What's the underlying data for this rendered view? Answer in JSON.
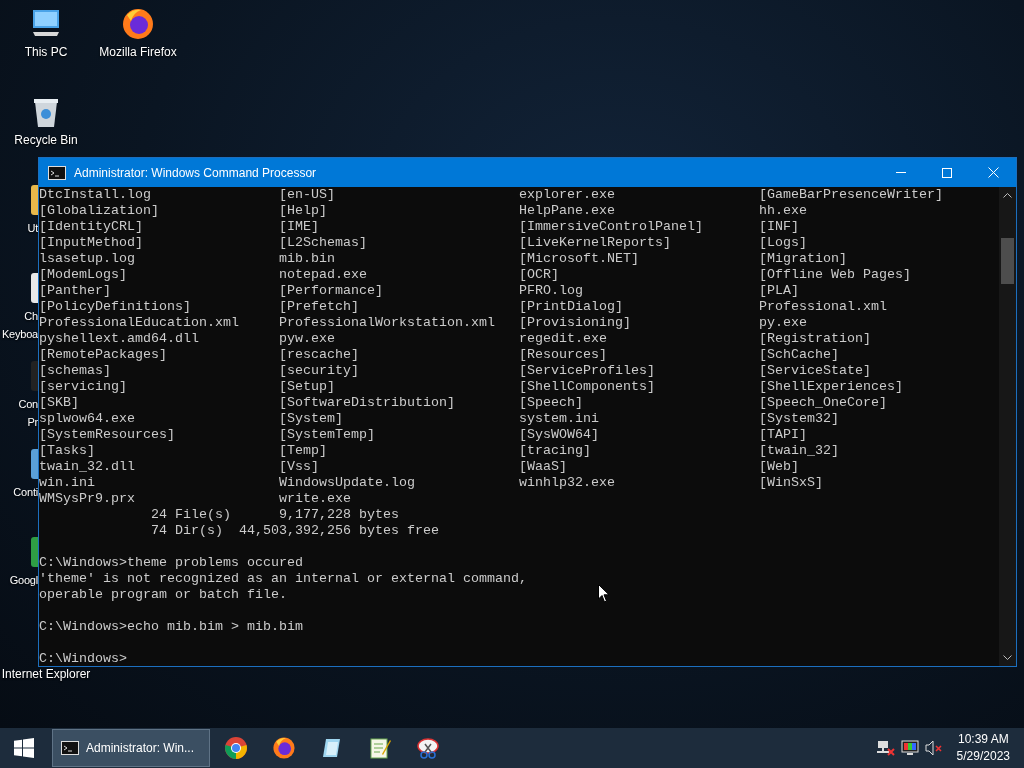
{
  "desktop": {
    "columns": [
      [
        {
          "kind": "pc",
          "label_lines": [
            "This PC"
          ],
          "partly_hidden": false
        },
        {
          "kind": "bin",
          "label_lines": [
            "Recycle Bin"
          ],
          "partly_hidden": false
        },
        {
          "kind": "folder",
          "label_lines": [
            "Ut"
          ],
          "partly_hidden": true
        },
        {
          "kind": "keyboard",
          "label_lines": [
            "Ch",
            "Keyboa"
          ],
          "partly_hidden": true
        },
        {
          "kind": "console",
          "label_lines": [
            "Con",
            "Pr"
          ],
          "partly_hidden": true
        },
        {
          "kind": "control",
          "label_lines": [
            "Conti"
          ],
          "partly_hidden": true
        },
        {
          "kind": "chrome",
          "label_lines": [
            "Googl"
          ],
          "partly_hidden": true
        },
        {
          "kind": "ie",
          "label_lines": [
            "Internet Explorer"
          ],
          "partly_hidden": false
        }
      ],
      [
        {
          "kind": "firefox",
          "label_lines": [
            "Mozilla Firefox"
          ],
          "partly_hidden": false
        }
      ]
    ]
  },
  "window": {
    "title": "Administrator: Windows Command Processor",
    "listing": [
      [
        "DtcInstall.log",
        "[en-US]",
        "explorer.exe",
        "[GameBarPresenceWriter]"
      ],
      [
        "[Globalization]",
        "[Help]",
        "HelpPane.exe",
        "hh.exe"
      ],
      [
        "[IdentityCRL]",
        "[IME]",
        "[ImmersiveControlPanel]",
        "[INF]"
      ],
      [
        "[InputMethod]",
        "[L2Schemas]",
        "[LiveKernelReports]",
        "[Logs]"
      ],
      [
        "lsasetup.log",
        "mib.bin",
        "[Microsoft.NET]",
        "[Migration]"
      ],
      [
        "[ModemLogs]",
        "notepad.exe",
        "[OCR]",
        "[Offline Web Pages]"
      ],
      [
        "[Panther]",
        "[Performance]",
        "PFRO.log",
        "[PLA]"
      ],
      [
        "[PolicyDefinitions]",
        "[Prefetch]",
        "[PrintDialog]",
        "Professional.xml"
      ],
      [
        "ProfessionalEducation.xml",
        "ProfessionalWorkstation.xml",
        "[Provisioning]",
        "py.exe"
      ],
      [
        "pyshellext.amd64.dll",
        "pyw.exe",
        "regedit.exe",
        "[Registration]"
      ],
      [
        "[RemotePackages]",
        "[rescache]",
        "[Resources]",
        "[SchCache]"
      ],
      [
        "[schemas]",
        "[security]",
        "[ServiceProfiles]",
        "[ServiceState]"
      ],
      [
        "[servicing]",
        "[Setup]",
        "[ShellComponents]",
        "[ShellExperiences]"
      ],
      [
        "[SKB]",
        "[SoftwareDistribution]",
        "[Speech]",
        "[Speech_OneCore]"
      ],
      [
        "splwow64.exe",
        "[System]",
        "system.ini",
        "[System32]"
      ],
      [
        "[SystemResources]",
        "[SystemTemp]",
        "[SysWOW64]",
        "[TAPI]"
      ],
      [
        "[Tasks]",
        "[Temp]",
        "[tracing]",
        "[twain_32]"
      ],
      [
        "twain_32.dll",
        "[Vss]",
        "[WaaS]",
        "[Web]"
      ],
      [
        "win.ini",
        "WindowsUpdate.log",
        "winhlp32.exe",
        "[WinSxS]"
      ],
      [
        "WMSysPr9.prx",
        "write.exe"
      ]
    ],
    "blocks": [
      [
        "              24 File(s)      9,177,228 bytes",
        "              74 Dir(s)  44,503,392,256 bytes free"
      ],
      [
        "C:\\Windows>theme problems occured",
        "'theme' is not recognized as an internal or external command,",
        "operable program or batch file."
      ],
      [
        "C:\\Windows>echo mib.bim > mib.bim"
      ],
      [
        "C:\\Windows>"
      ]
    ]
  },
  "taskbar": {
    "active_task": "Administrator: Win...",
    "pinned": [
      {
        "kind": "chrome"
      },
      {
        "kind": "firefox"
      },
      {
        "kind": "notepad"
      },
      {
        "kind": "editor"
      },
      {
        "kind": "snip"
      }
    ],
    "time": "10:39 AM",
    "date": "5/29/2023"
  }
}
